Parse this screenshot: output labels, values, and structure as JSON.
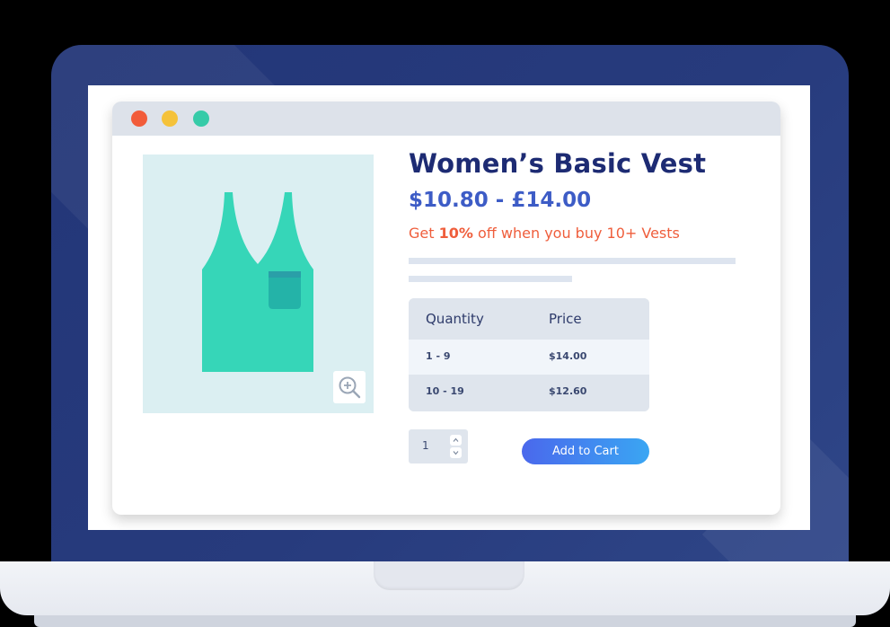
{
  "browser": {
    "window_controls": [
      "close",
      "minimize",
      "maximize"
    ]
  },
  "product": {
    "title": "Women’s Basic Vest",
    "price_range": "$10.80 - £14.00",
    "promo": {
      "prefix": "Get ",
      "highlight": "10%",
      "suffix": " off when you buy 10+ Vests"
    },
    "image": {
      "icon": "vest-icon",
      "zoom_icon": "zoom-in-icon"
    }
  },
  "pricing_table": {
    "headers": [
      "Quantity",
      "Price"
    ],
    "rows": [
      {
        "quantity": "1 - 9",
        "price": "$14.00"
      },
      {
        "quantity": "10 - 19",
        "price": "$12.60"
      }
    ]
  },
  "cart": {
    "quantity": "1",
    "add_to_cart_label": "Add to Cart"
  },
  "colors": {
    "title": "#1d2b73",
    "price": "#3d5cc6",
    "promo": "#ef5e3c",
    "vest": "#36d6b8",
    "laptop_lid": "#273b7d",
    "button_start": "#4a68ec",
    "button_end": "#3aa6f3"
  }
}
